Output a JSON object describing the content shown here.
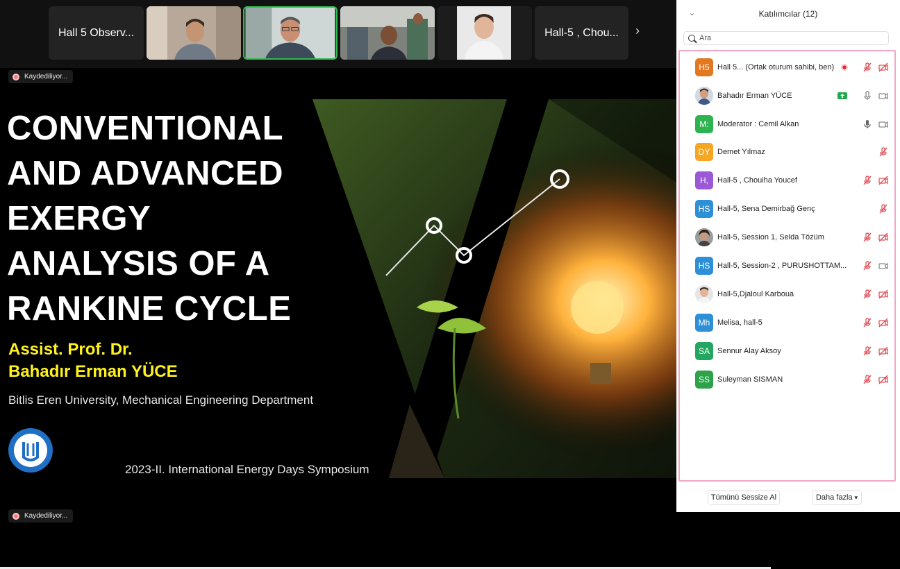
{
  "gallery": {
    "tiles": [
      {
        "label": "Hall 5 Observ..."
      },
      {
        "label": "Hall-5 , Chou..."
      }
    ],
    "next_icon": "chevron-right-icon"
  },
  "recording": {
    "top_label": "Kaydediliyor...",
    "bottom_label": "Kaydediliyor..."
  },
  "slide": {
    "title_lines": [
      "CONVENTIONAL",
      "AND ADVANCED",
      "EXERGY",
      "ANALYSIS OF A",
      "RANKINE CYCLE"
    ],
    "author_lines": [
      "Assist. Prof. Dr.",
      "Bahadır Erman YÜCE"
    ],
    "affiliation": "Bitlis Eren University, Mechanical Engineering Department",
    "symposium": "2023-II. International Energy Days Symposium",
    "title_color": "#ffffff",
    "author_color": "#fff21a"
  },
  "participants_panel": {
    "title": "Katılımcılar (12)",
    "search_placeholder": "Ara",
    "participants": [
      {
        "initials": "H5",
        "color": "#e2781f",
        "name": "Hall 5...  (Ortak oturum sahibi, ben)"
      },
      {
        "initials": "",
        "color": "#cccccc",
        "name": "Bahadır Erman YÜCE"
      },
      {
        "initials": "M:",
        "color": "#2eb351",
        "name": "Moderator : Cemil Alkan"
      },
      {
        "initials": "DY",
        "color": "#f5a623",
        "name": "Demet Yılmaz"
      },
      {
        "initials": "H,",
        "color": "#9b59d6",
        "name": "Hall-5 , Chouiha Youcef"
      },
      {
        "initials": "HS",
        "color": "#2d8fd5",
        "name": "Hall-5, Sena Demirbağ Genç"
      },
      {
        "initials": "",
        "color": "#aaaaaa",
        "name": "Hall-5, Session 1, Selda Tözüm"
      },
      {
        "initials": "HS",
        "color": "#2d8fd5",
        "name": "Hall-5, Session-2 , PURUSHOTTAM..."
      },
      {
        "initials": "",
        "color": "#d9d9d9",
        "name": "Hall-5,Djaloul Karboua"
      },
      {
        "initials": "Mh",
        "color": "#2d8fd5",
        "name": "Melisa, hall-5"
      },
      {
        "initials": "SA",
        "color": "#23a65f",
        "name": "Sennur Alay Aksoy"
      },
      {
        "initials": "SS",
        "color": "#2da24a",
        "name": "Suleyman SISMAN"
      }
    ],
    "mute_all_label": "Tümünü Sessize Al",
    "more_label": "Daha fazla"
  },
  "colors": {
    "highlight_border": "#f3a6c6",
    "active_speaker": "#2fbb4f",
    "muted_icon": "#e0535a"
  }
}
